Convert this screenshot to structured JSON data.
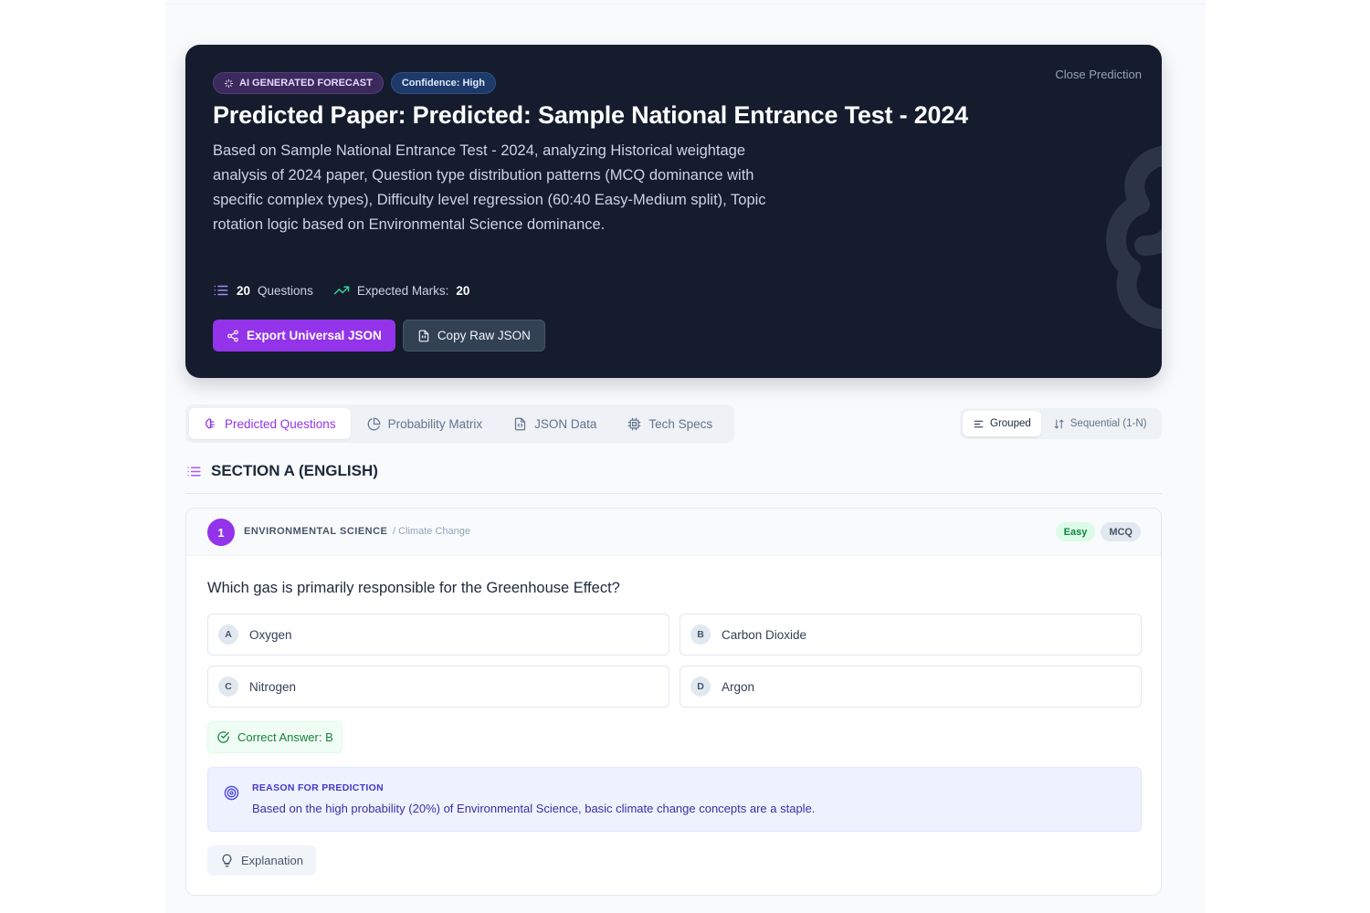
{
  "hero": {
    "badge_ai": "AI GENERATED FORECAST",
    "badge_confidence": "Confidence: High",
    "close_label": "Close Prediction",
    "title": "Predicted Paper: Predicted: Sample National Entrance Test - 2024",
    "description": "Based on Sample National Entrance Test - 2024, analyzing Historical weightage analysis of 2024 paper, Question type distribution patterns (MCQ dominance with specific complex types), Difficulty level regression (60:40 Easy-Medium split), Topic rotation logic based on Environmental Science dominance.",
    "questions_count": "20",
    "questions_label": "Questions",
    "marks_label": "Expected Marks:",
    "marks_value": "20",
    "export_label": "Export Universal JSON",
    "copy_label": "Copy Raw JSON"
  },
  "tabs": [
    {
      "label": "Predicted Questions",
      "icon": "brain-icon",
      "active": true
    },
    {
      "label": "Probability Matrix",
      "icon": "pie-chart-icon",
      "active": false
    },
    {
      "label": "JSON Data",
      "icon": "file-code-icon",
      "active": false
    },
    {
      "label": "Tech Specs",
      "icon": "cpu-icon",
      "active": false
    }
  ],
  "view_toggle": {
    "grouped": "Grouped",
    "sequential": "Sequential (1-N)",
    "active": "grouped"
  },
  "section": {
    "title": "SECTION A (ENGLISH)"
  },
  "question": {
    "number": "1",
    "subject": "ENVIRONMENTAL SCIENCE",
    "topic": "/ Climate Change",
    "difficulty": "Easy",
    "type": "MCQ",
    "text": "Which gas is primarily responsible for the Greenhouse Effect?",
    "options": [
      {
        "letter": "A",
        "text": "Oxygen"
      },
      {
        "letter": "B",
        "text": "Carbon Dioxide"
      },
      {
        "letter": "C",
        "text": "Nitrogen"
      },
      {
        "letter": "D",
        "text": "Argon"
      }
    ],
    "correct_answer": "Correct Answer: B",
    "reason_title": "REASON FOR PREDICTION",
    "reason_text": "Based on the high probability (20%) of Environmental Science, basic climate change concepts are a staple.",
    "explanation_label": "Explanation"
  },
  "colors": {
    "accent": "#9333ea",
    "hero_bg": "#141c2d",
    "success": "#15803d",
    "reason": "#4338ca"
  }
}
